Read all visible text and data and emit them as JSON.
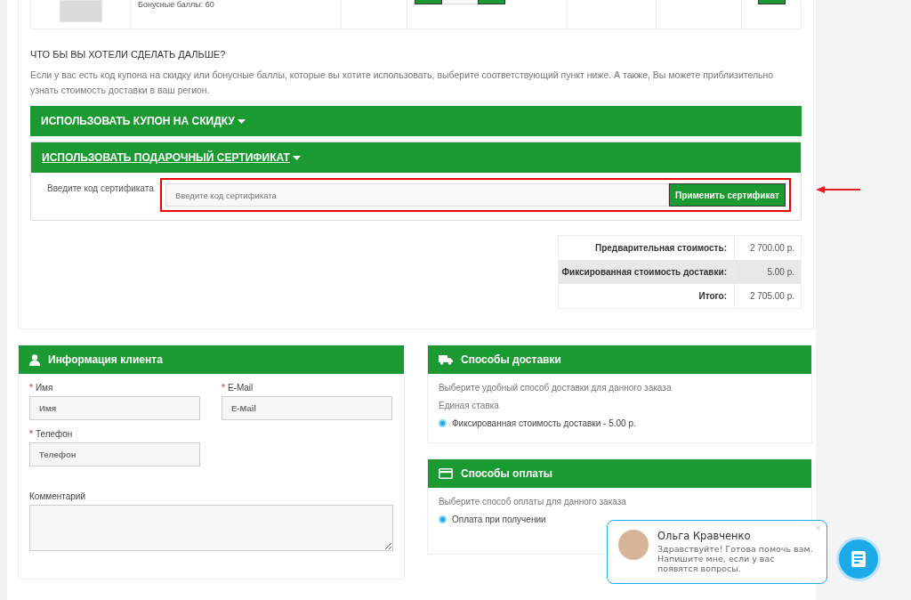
{
  "product_row": {
    "bonus_text": "Бонусные баллы: 60"
  },
  "next_steps": {
    "heading": "ЧТО БЫ ВЫ ХОТЕЛИ СДЕЛАТЬ ДАЛЬШЕ?",
    "text": "Если у вас есть код купона на скидку или бонусные баллы, которые вы хотите использовать, выберите соответствующий пункт ниже. А также, Вы можете приблизительно узнать стоимость доставки в ваш регион.",
    "panels": [
      {
        "title": "ИСПОЛЬЗОВАТЬ КУПОН НА СКИДКУ",
        "expanded": false
      },
      {
        "title": "ИСПОЛЬЗОВАТЬ ПОДАРОЧНЫЙ СЕРТИФИКАТ",
        "expanded": true,
        "field_label": "Введите код сертификата",
        "placeholder": "Введите код сертификата",
        "button": "Применить сертификат"
      }
    ]
  },
  "totals": [
    {
      "label": "Предварительная стоимость:",
      "value": "2 700.00 р.",
      "selected": false
    },
    {
      "label": "Фиксированная стоимость доставки:",
      "value": "5.00 р.",
      "selected": true
    },
    {
      "label": "Итого:",
      "value": "2 705.00 р.",
      "selected": false
    }
  ],
  "customer": {
    "title": "Информация клиента",
    "fields": [
      {
        "label": "Имя",
        "placeholder": "Имя",
        "required_mark": "*"
      },
      {
        "label": "E-Mail",
        "placeholder": "E-Mail",
        "required_mark": "*"
      },
      {
        "label": "Телефон",
        "placeholder": "Телефон",
        "required_mark": "*"
      }
    ],
    "comment_label": "Комментарий"
  },
  "delivery": {
    "title": "Способы доставки",
    "hint": "Выберите удобный способ доставки для данного заказа",
    "group": "Единая ставка",
    "options": [
      {
        "label": "Фиксированная стоимость доставки - 5.00 р.",
        "selected": true
      }
    ]
  },
  "payment": {
    "title": "Способы оплаты",
    "hint": "Выберите способ оплаты для данного заказа",
    "options": [
      {
        "label": "Оплата при получении",
        "selected": true
      }
    ]
  },
  "chat": {
    "name": "Ольга Кравченко",
    "message": "Здравствуйте! Готова помочь вам. Напишите мне, если у вас появятся вопросы.",
    "close": "×"
  }
}
